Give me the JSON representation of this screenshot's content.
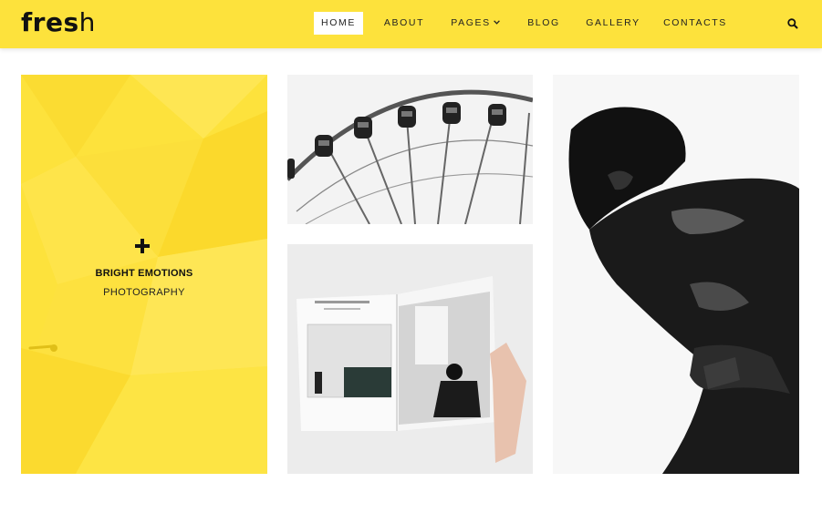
{
  "brand": {
    "logo_bold": "fres",
    "logo_light": "h"
  },
  "nav": {
    "items": [
      {
        "label": "HOME",
        "active": true
      },
      {
        "label": "ABOUT"
      },
      {
        "label": "PAGES"
      },
      {
        "label": "BLOG"
      },
      {
        "label": "GALLERY"
      },
      {
        "label": "CONTACTS"
      }
    ],
    "search_icon": "search-icon",
    "dropdown_icon": "chevron-down-icon"
  },
  "feature": {
    "icon": "plus-icon",
    "title": "BRIGHT EMOTIONS",
    "subtitle": "PHOTOGRAPHY"
  },
  "gallery": {
    "images": [
      {
        "name": "ferris-wheel-photo"
      },
      {
        "name": "open-photo-book-photo"
      },
      {
        "name": "black-and-white-portrait-photo"
      }
    ]
  },
  "colors": {
    "accent": "#fde23c",
    "text": "#111111",
    "background": "#ffffff"
  }
}
